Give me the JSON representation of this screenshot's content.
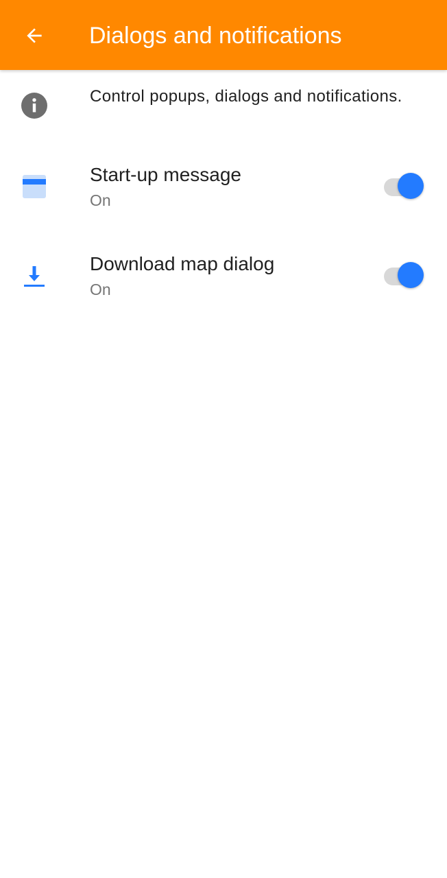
{
  "colors": {
    "toolbar": "#FF8800",
    "accent": "#237BFF",
    "info_icon": "#6E6E6E"
  },
  "toolbar": {
    "back_icon": "arrow-back-icon",
    "title": "Dialogs and notifications"
  },
  "info": {
    "icon": "info-icon",
    "text": "Control popups, dialogs and notifications."
  },
  "settings": [
    {
      "icon": "startup-message-icon",
      "title": "Start-up message",
      "status": "On",
      "enabled": true
    },
    {
      "icon": "download-icon",
      "title": "Download map dialog",
      "status": "On",
      "enabled": true
    }
  ]
}
